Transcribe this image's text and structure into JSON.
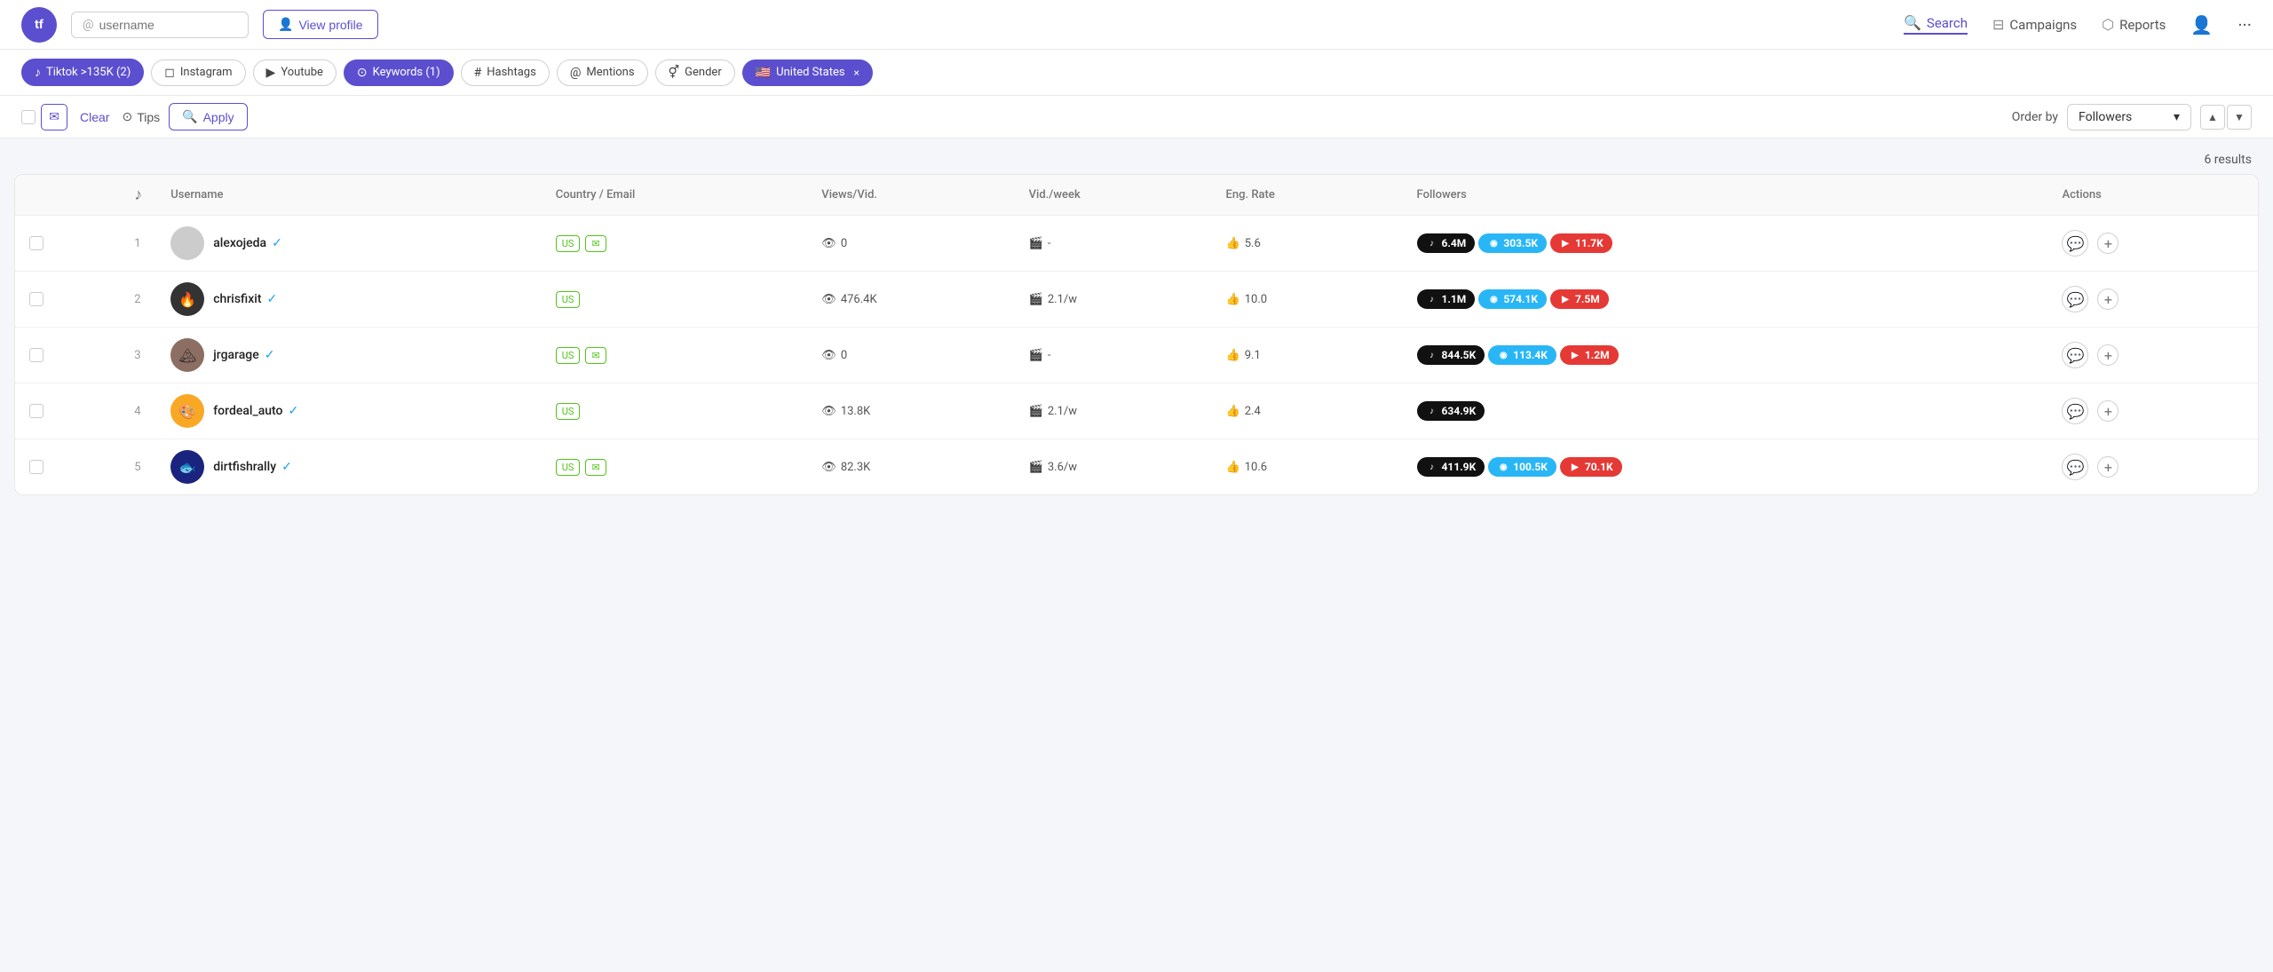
{
  "logo": {
    "text": "tf"
  },
  "header": {
    "username_placeholder": "username",
    "view_profile_label": "View profile",
    "search_label": "Search",
    "campaigns_label": "Campaigns",
    "reports_label": "Reports"
  },
  "filters": [
    {
      "id": "tiktok",
      "label": "Tiktok >135K (2)",
      "icon": "♪",
      "active": true
    },
    {
      "id": "instagram",
      "label": "Instagram",
      "icon": "◻",
      "active": false
    },
    {
      "id": "youtube",
      "label": "Youtube",
      "icon": "▶",
      "active": false
    },
    {
      "id": "keywords",
      "label": "Keywords (1)",
      "icon": "⊙",
      "active": true
    },
    {
      "id": "hashtags",
      "label": "Hashtags",
      "icon": "#",
      "active": false
    },
    {
      "id": "mentions",
      "label": "Mentions",
      "icon": "@",
      "active": false
    },
    {
      "id": "gender",
      "label": "Gender",
      "icon": "⚥",
      "active": false
    },
    {
      "id": "country",
      "label": "United States",
      "icon": "🇺🇸",
      "active": true,
      "removable": true
    }
  ],
  "toolbar": {
    "clear_label": "Clear",
    "tips_label": "Tips",
    "apply_label": "Apply",
    "order_by_label": "Order by",
    "order_by_value": "Followers"
  },
  "results": {
    "count_label": "6 results"
  },
  "table": {
    "columns": [
      "",
      "",
      "Username",
      "Country / Email",
      "Views/Vid.",
      "Vid./week",
      "Eng. Rate",
      "Followers",
      "",
      "Actions"
    ],
    "rows": [
      {
        "num": "1",
        "avatar_type": "gray",
        "avatar_text": "",
        "username": "alexojeda",
        "verified": true,
        "country": "US",
        "has_email": true,
        "views": "0",
        "vid_week": "-",
        "eng_rate": "5.6",
        "followers": [
          {
            "platform": "tiktok",
            "value": "6.4M"
          },
          {
            "platform": "instagram",
            "value": "303.5K"
          },
          {
            "platform": "youtube",
            "value": "11.7K"
          }
        ]
      },
      {
        "num": "2",
        "avatar_type": "dark",
        "avatar_text": "🔥",
        "username": "chrisfixit",
        "verified": true,
        "country": "US",
        "has_email": false,
        "views": "476.4K",
        "vid_week": "2.1/w",
        "eng_rate": "10.0",
        "followers": [
          {
            "platform": "tiktok",
            "value": "1.1M"
          },
          {
            "platform": "instagram",
            "value": "574.1K"
          },
          {
            "platform": "youtube",
            "value": "7.5M"
          }
        ]
      },
      {
        "num": "3",
        "avatar_type": "landscape",
        "avatar_text": "🏔",
        "username": "jrgarage",
        "verified": true,
        "country": "US",
        "has_email": true,
        "views": "0",
        "vid_week": "-",
        "eng_rate": "9.1",
        "followers": [
          {
            "platform": "tiktok",
            "value": "844.5K"
          },
          {
            "platform": "instagram",
            "value": "113.4K"
          },
          {
            "platform": "youtube",
            "value": "1.2M"
          }
        ]
      },
      {
        "num": "4",
        "avatar_type": "cartoon",
        "avatar_text": "🎨",
        "username": "fordeal_auto",
        "verified": true,
        "country": "US",
        "has_email": false,
        "views": "13.8K",
        "vid_week": "2.1/w",
        "eng_rate": "2.4",
        "followers": [
          {
            "platform": "tiktok",
            "value": "634.9K"
          }
        ]
      },
      {
        "num": "5",
        "avatar_type": "dark2",
        "avatar_text": "🐟",
        "username": "dirtfishrally",
        "verified": true,
        "country": "US",
        "has_email": true,
        "views": "82.3K",
        "vid_week": "3.6/w",
        "eng_rate": "10.6",
        "followers": [
          {
            "platform": "tiktok",
            "value": "411.9K"
          },
          {
            "platform": "instagram",
            "value": "100.5K"
          },
          {
            "platform": "youtube",
            "value": "70.1K"
          }
        ]
      }
    ]
  }
}
